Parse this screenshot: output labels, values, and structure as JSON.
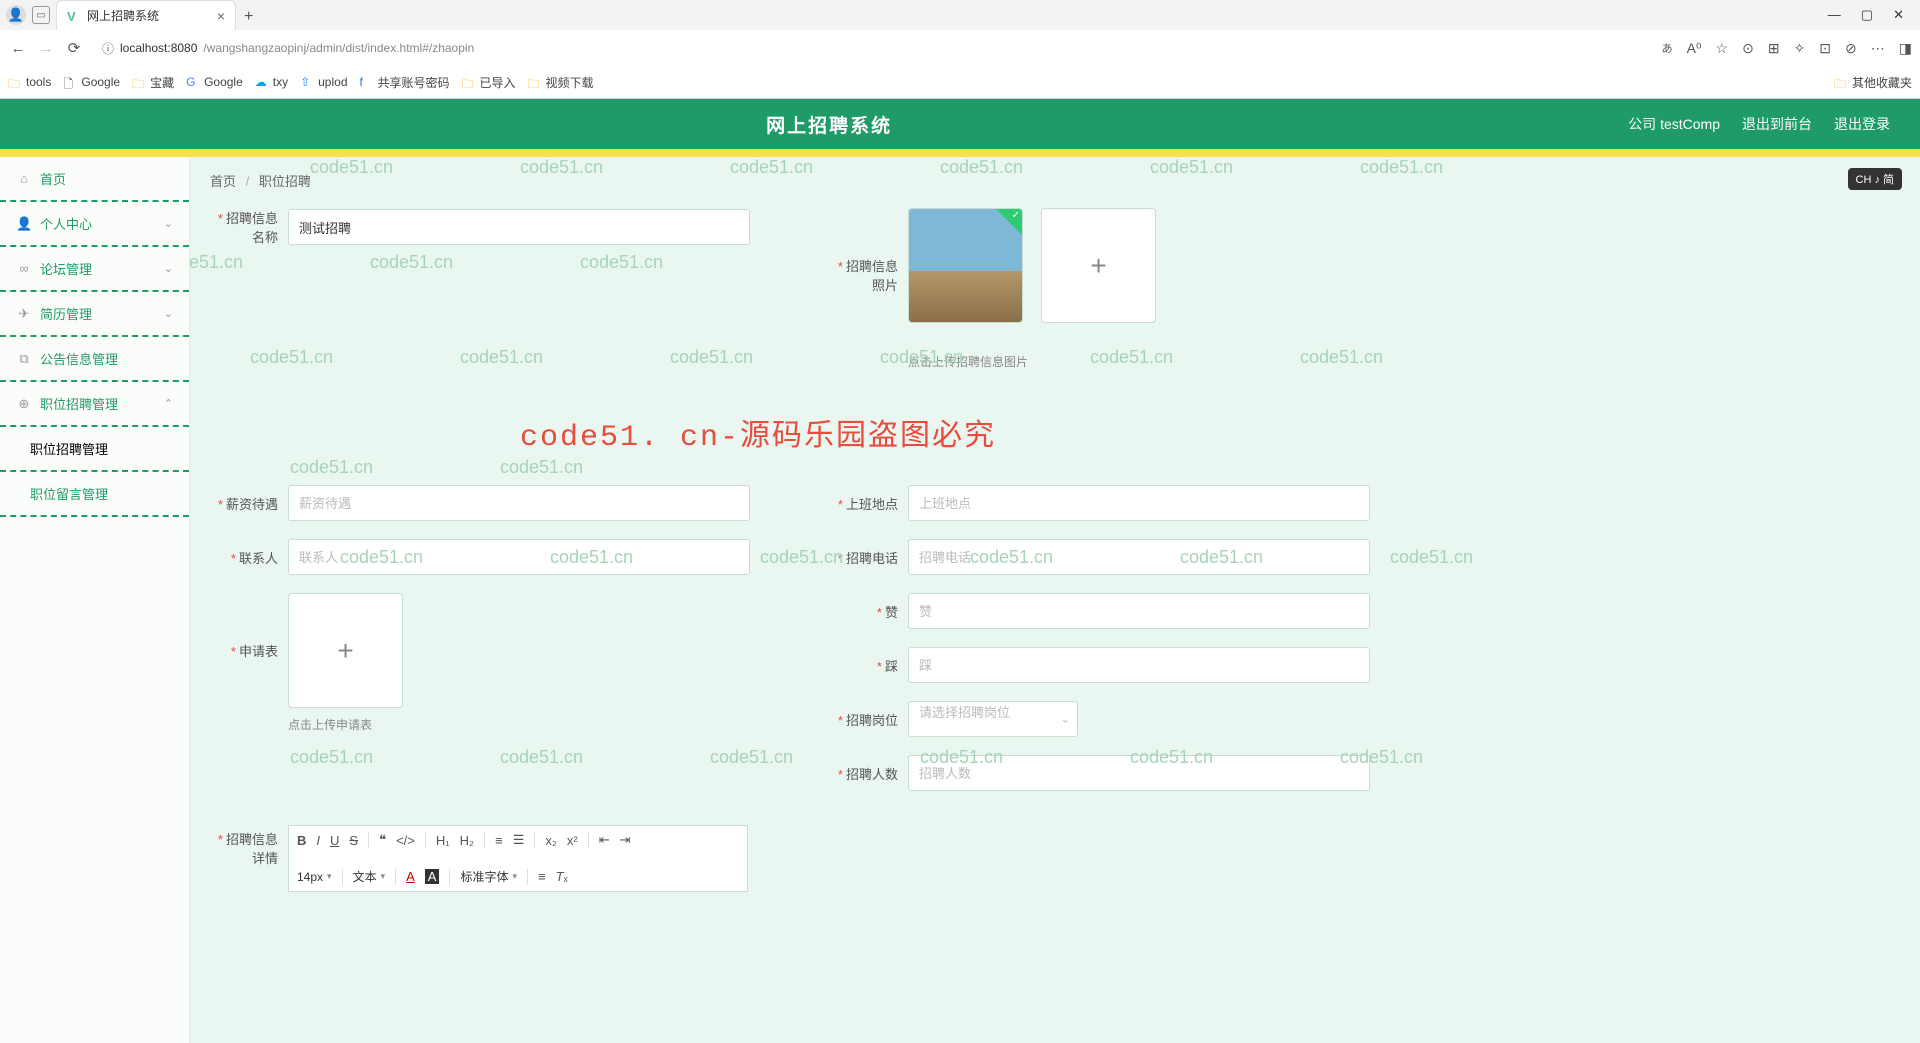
{
  "browser": {
    "tab_title": "网上招聘系统",
    "url_host": "localhost:8080",
    "url_path": "/wangshangzaopinj/admin/dist/index.html#/zhaopin",
    "bookmarks": [
      "tools",
      "Google",
      "宝藏",
      "Google",
      "txy",
      "uplod",
      "共享账号密码",
      "已导入",
      "视频下载"
    ],
    "other_bookmarks": "其他收藏夹"
  },
  "header": {
    "app_title": "网上招聘系统",
    "user_label": "公司 testComp",
    "logout_front": "退出到前台",
    "logout": "退出登录"
  },
  "sidebar": {
    "home": "首页",
    "personal": "个人中心",
    "forum": "论坛管理",
    "resume": "简历管理",
    "notice": "公告信息管理",
    "recruit_mgmt": "职位招聘管理",
    "sub_recruit": "职位招聘管理",
    "sub_message": "职位留言管理"
  },
  "breadcrumb": {
    "home": "首页",
    "current": "职位招聘"
  },
  "form": {
    "recruit_name_label": "招聘信息名称",
    "recruit_name_value": "测试招聘",
    "recruit_photo_label": "招聘信息照片",
    "upload_hint": "点击上传招聘信息图片",
    "salary_label": "薪资待遇",
    "salary_placeholder": "薪资待遇",
    "work_location_label": "上班地点",
    "work_location_placeholder": "上班地点",
    "contact_label": "联系人",
    "contact_placeholder": "联系人",
    "phone_label": "招聘电话",
    "phone_placeholder": "招聘电话",
    "application_label": "申请表",
    "application_hint": "点击上传申请表",
    "like_label": "赞",
    "like_placeholder": "赞",
    "dislike_label": "踩",
    "dislike_placeholder": "踩",
    "position_label": "招聘岗位",
    "position_placeholder": "请选择招聘岗位",
    "headcount_label": "招聘人数",
    "headcount_placeholder": "招聘人数",
    "detail_label": "招聘信息详情"
  },
  "editor": {
    "font_size": "14px",
    "text_style": "文本",
    "font_family": "标准字体"
  },
  "watermark_big": "code51. cn-源码乐园盗图必究",
  "watermark_small": "code51.cn",
  "ime": "CH ♪ 简"
}
